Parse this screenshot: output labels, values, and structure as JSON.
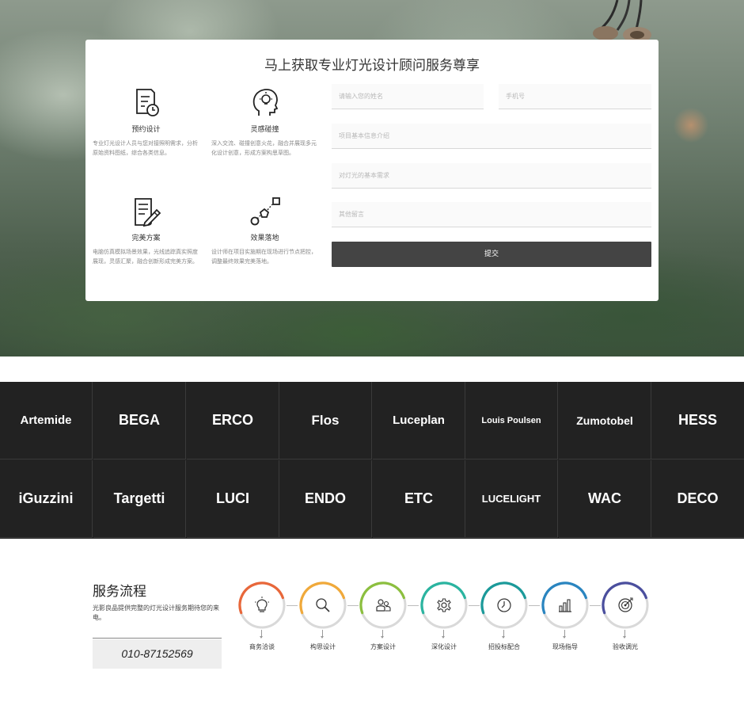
{
  "form": {
    "title": "马上获取专业灯光设计顾问服务尊享",
    "features": [
      {
        "name": "预约设计",
        "desc": "专业灯光设计人员与您对接照明需求，分析原始资料图纸，综合各类信息。",
        "icon": "document-clock-icon"
      },
      {
        "name": "灵感碰撞",
        "desc": "深入交流、碰撞创意火花，融合并展现多元化设计创意，形成方案构思草图。",
        "icon": "head-lightbulb-icon"
      },
      {
        "name": "完美方案",
        "desc": "电脑仿真模拟场景效果，光线追踪真实照度展现，灵感汇聚，融合创新形成完美方案。",
        "icon": "document-pen-icon"
      },
      {
        "name": "效果落地",
        "desc": "设计师在项目实施期在现场进行节点把控，调整最终效果完美落地。",
        "icon": "shapes-flow-icon"
      }
    ],
    "placeholders": {
      "name": "请输入您的姓名",
      "phone": "手机号",
      "project": "项目基本信息介绍",
      "lighting": "对灯光的基本需求",
      "message": "其他留言"
    },
    "submit_label": "提交"
  },
  "brands": [
    "Artemide",
    "BEGA",
    "ERCO",
    "Flos",
    "Luceplan",
    "Louis Poulsen",
    "Zumotobel",
    "HESS",
    "iGuzzini",
    "Targetti",
    "LUCI",
    "ENDO",
    "ETC",
    "LUCELIGHT",
    "WAC",
    "DECO"
  ],
  "process": {
    "title": "服务流程",
    "desc": "光影良品提供完整的灯光设计服务期待您的来电。",
    "phone": "010-87152569",
    "steps": [
      {
        "label": "商务洽谈",
        "icon": "lightbulb-icon",
        "color": "#e8673a"
      },
      {
        "label": "构思设计",
        "icon": "magnifier-icon",
        "color": "#f0a93a"
      },
      {
        "label": "方案设计",
        "icon": "users-icon",
        "color": "#8cbf3f"
      },
      {
        "label": "深化设计",
        "icon": "gear-icon",
        "color": "#2bb4a0"
      },
      {
        "label": "招投标配合",
        "icon": "clock-icon",
        "color": "#1b9a9a"
      },
      {
        "label": "现场指导",
        "icon": "bar-chart-icon",
        "color": "#2a85c0"
      },
      {
        "label": "验收调光",
        "icon": "target-icon",
        "color": "#4b4f9e"
      }
    ]
  }
}
